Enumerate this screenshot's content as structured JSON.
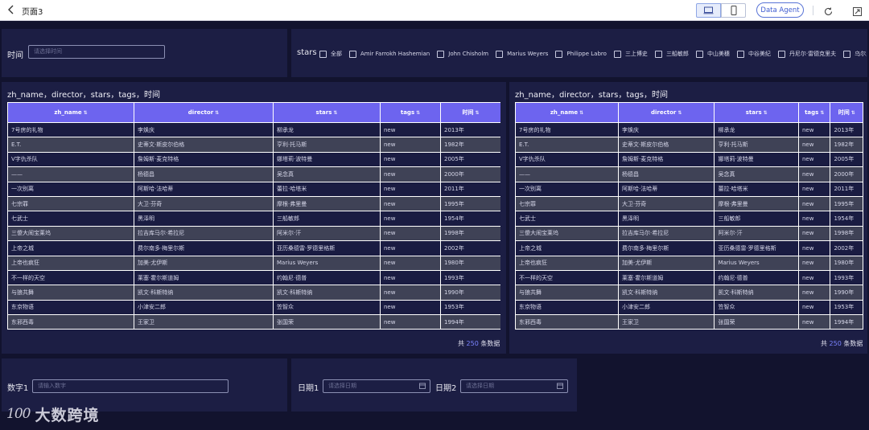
{
  "topbar": {
    "title": "页面3",
    "agent_button": "Data Agent"
  },
  "filters": {
    "time_label": "时间",
    "time_placeholder": "请选择时间",
    "stars_label": "stars",
    "stars_options": [
      "全部",
      "Amir Farrokh Hashemian",
      "John Chisholm",
      "Marius Weyers",
      "Philippe Labro",
      "三上博史",
      "三船敏郎",
      "中山美穗",
      "中谷美纪",
      "丹尼尔·雷德克里夫",
      "乌尔里希"
    ],
    "number_label": "数字1",
    "number_placeholder": "请输入数字",
    "date1_label": "日期1",
    "date1_placeholder": "请选择日期",
    "date2_label": "日期2",
    "date2_placeholder": "请选择日期"
  },
  "tables": {
    "title": "zh_name，director，stars，tags，时间",
    "columns": [
      "zh_name",
      "director",
      "stars",
      "tags",
      "时间"
    ],
    "rows": [
      [
        "7号房的礼物",
        "李焕庆",
        "柳承龙",
        "new",
        "2013年"
      ],
      [
        "E.T.",
        "史蒂文·斯皮尔伯格",
        "亨利·托马斯",
        "new",
        "1982年"
      ],
      [
        "V字仇杀队",
        "詹姆斯·麦克特格",
        "娜塔莉·波特曼",
        "new",
        "2005年"
      ],
      [
        "——",
        "杨德昌",
        "吴念真",
        "new",
        "2000年"
      ],
      [
        "一次别离",
        "阿斯哈·法哈蒂",
        "蕾拉·哈塔米",
        "new",
        "2011年"
      ],
      [
        "七宗罪",
        "大卫·芬奇",
        "摩根·弗里曼",
        "new",
        "1995年"
      ],
      [
        "七武士",
        "黑泽明",
        "三船敏郎",
        "new",
        "1954年"
      ],
      [
        "三傻大闹宝莱坞",
        "拉吉库马尔·希拉尼",
        "阿米尔·汗",
        "new",
        "1998年"
      ],
      [
        "上帝之城",
        "费尔南多·梅里尔斯",
        "亚历桑德雷·罗德里格斯",
        "new",
        "2002年"
      ],
      [
        "上帝也疯狂",
        "加美·尤伊斯",
        "Marius Weyers",
        "new",
        "1980年"
      ],
      [
        "不一样的天空",
        "莱塞·霍尔斯道姆",
        "约翰尼·德普",
        "new",
        "1993年"
      ],
      [
        "与狼共舞",
        "凯文·科斯特纳",
        "凯文·科斯特纳",
        "new",
        "1990年"
      ],
      [
        "东京物语",
        "小津安二郎",
        "笠智众",
        "new",
        "1953年"
      ],
      [
        "东邪西毒",
        "王家卫",
        "张国荣",
        "new",
        "1994年"
      ]
    ],
    "total_prefix": "共",
    "total_count": "250",
    "total_suffix": "条数据"
  },
  "logo": {
    "mark": "100",
    "text": "大数跨境"
  },
  "colors": {
    "background": "#12132e",
    "panel": "#1c1e44",
    "header": "#6d64ef",
    "accent": "#7b84ff"
  }
}
